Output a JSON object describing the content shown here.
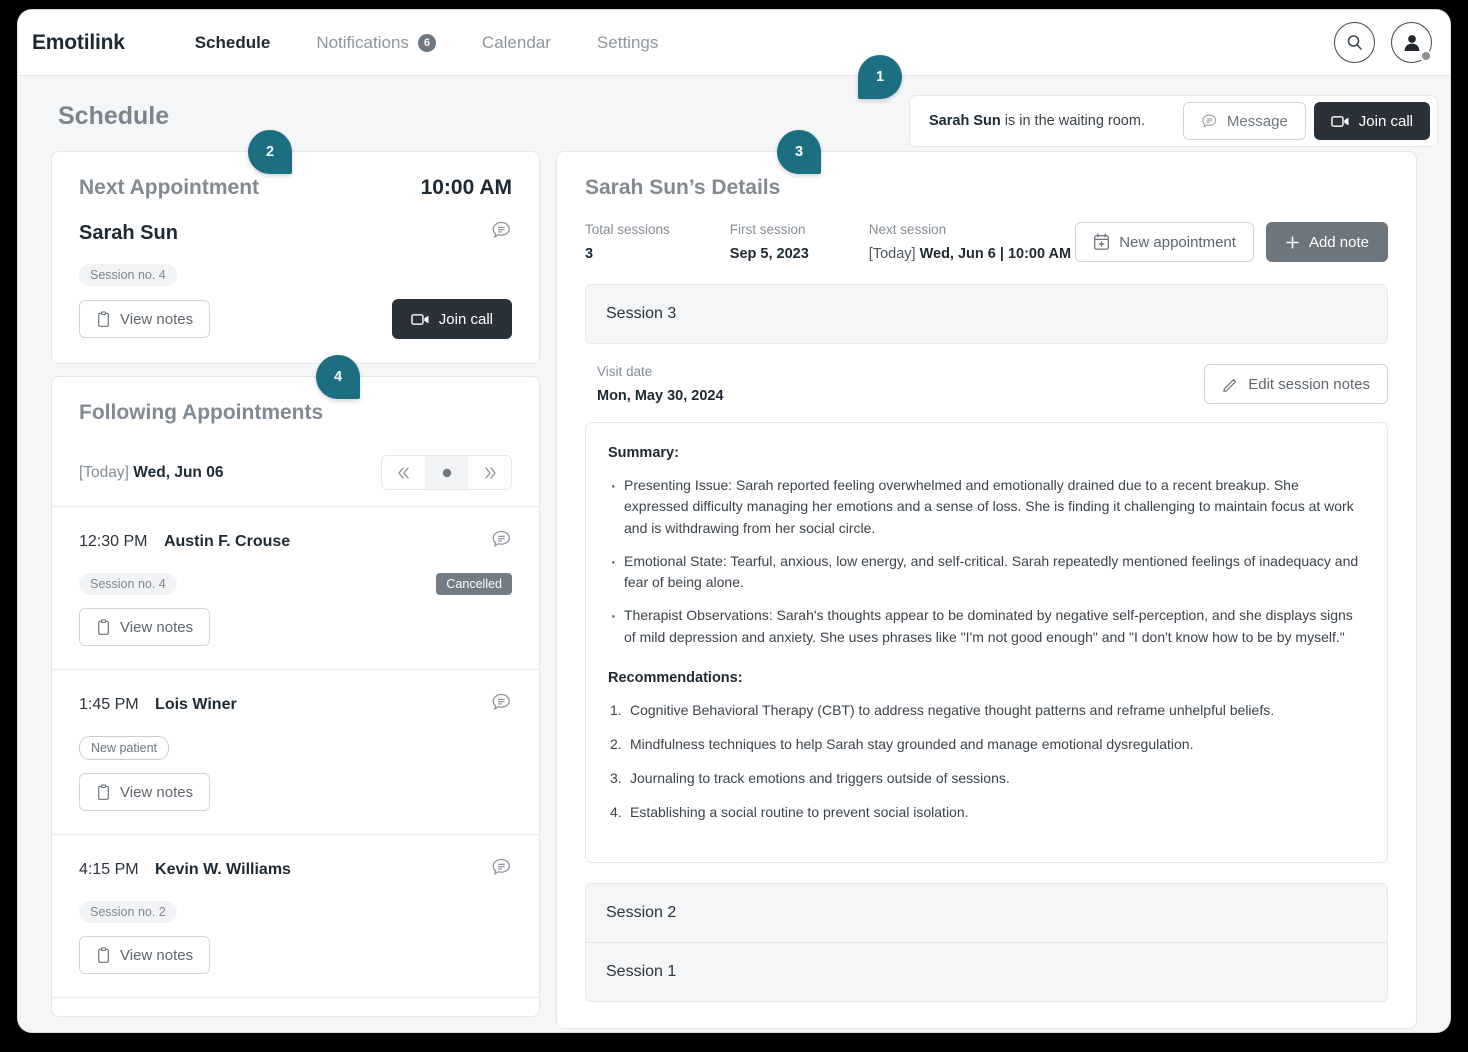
{
  "app": {
    "brand": "Emotilink"
  },
  "nav": {
    "items": [
      {
        "label": "Schedule",
        "active": true
      },
      {
        "label": "Notifications",
        "badge": "6",
        "active": false
      },
      {
        "label": "Calendar",
        "active": false
      },
      {
        "label": "Settings",
        "active": false
      }
    ]
  },
  "waiting": {
    "patient": "Sarah Sun",
    "text": " is in the waiting room.",
    "message_label": "Message",
    "join_label": "Join call"
  },
  "page": {
    "title": "Schedule"
  },
  "next_appointment": {
    "title": "Next Appointment",
    "time": "10:00 AM",
    "patient": "Sarah Sun",
    "session_chip": "Session no.  4",
    "view_notes": "View notes",
    "join_call": "Join call"
  },
  "following": {
    "title": "Following Appointments",
    "today_label": "[Today]",
    "date": "Wed, Jun 06",
    "appointments": [
      {
        "time": "12:30 PM",
        "name": "Austin F. Crouse",
        "chip": "Session no.  4",
        "chip_style": "filled",
        "status": "Cancelled",
        "view_notes": "View notes"
      },
      {
        "time": "1:45 PM",
        "name": "Lois Winer",
        "chip": "New patient",
        "chip_style": "outline",
        "status": "",
        "view_notes": "View notes"
      },
      {
        "time": "4:15 PM",
        "name": "Kevin W. Williams",
        "chip": "Session no.  2",
        "chip_style": "filled",
        "status": "",
        "view_notes": "View notes"
      }
    ]
  },
  "details": {
    "title": "Sarah Sun’s Details",
    "stats": [
      {
        "label": "Total sessions",
        "value": "3"
      },
      {
        "label": "First session",
        "value": "Sep 5, 2023"
      }
    ],
    "next_session_label": "Next session",
    "next_session_today": "[Today]",
    "next_session_value": "Wed, Jun 6 | 10:00 AM",
    "new_appointment": "New appointment",
    "add_note": "Add note",
    "session_open_title": "Session 3",
    "visit_date_label": "Visit date",
    "visit_date_value": "Mon, May 30, 2024",
    "edit_session_notes": "Edit session notes",
    "summary_heading": "Summary:",
    "summary_bullets": [
      "Presenting Issue: Sarah reported feeling overwhelmed and emotionally drained due to a recent breakup. She expressed difficulty managing her emotions and a sense of loss. She is finding it challenging to maintain focus at work and is withdrawing from her social circle.",
      "Emotional State: Tearful, anxious, low energy, and self-critical. Sarah repeatedly mentioned feelings of inadequacy and fear of being alone.",
      "Therapist Observations: Sarah's thoughts appear to be dominated by negative self-perception, and she displays signs of mild depression and anxiety. She uses phrases like \"I'm not good enough\" and \"I don't know how to be by myself.\""
    ],
    "recommendations_heading": "Recommendations:",
    "recommendations": [
      "Cognitive Behavioral Therapy (CBT) to address negative thought patterns and reframe unhelpful beliefs.",
      "Mindfulness techniques to help Sarah stay grounded and manage emotional dysregulation.",
      "Journaling to track emotions and triggers outside of sessions.",
      "Establishing a social routine to prevent social isolation."
    ],
    "collapsed_sessions": [
      "Session 2",
      "Session 1"
    ]
  },
  "markers": {
    "m1": "1",
    "m2": "2",
    "m3": "3",
    "m4": "4"
  },
  "colors": {
    "marker_teal": "#1b6f80",
    "dark_button": "#2b3138",
    "add_note_gray": "#6d757d",
    "status_badge_gray": "#737c85"
  }
}
